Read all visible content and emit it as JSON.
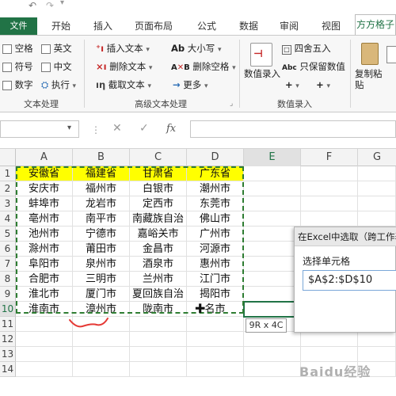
{
  "ribbon_tabs": [
    "文件",
    "开始",
    "插入",
    "页面布局",
    "公式",
    "数据",
    "审阅",
    "视图",
    "方方格子"
  ],
  "text_group": {
    "items": [
      "空格",
      "英文",
      "符号",
      "中文",
      "数字",
      "执行"
    ],
    "name": "文本处理"
  },
  "advanced_group": {
    "items": [
      "插入文本",
      "删除文本",
      "截取文本",
      "大小写",
      "删除空格",
      "更多"
    ],
    "name": "高级文本处理"
  },
  "number_group": {
    "big_button": "数值录入",
    "items": [
      "四舍五入",
      "只保留数值"
    ],
    "name": "数值录入"
  },
  "paste_button": "复制粘贴",
  "formula_bar": {
    "fx": "fx",
    "value": ""
  },
  "columns": [
    "A",
    "B",
    "C",
    "D",
    "E",
    "F",
    "G"
  ],
  "rows": [
    "1",
    "2",
    "3",
    "4",
    "5",
    "6",
    "7",
    "8",
    "9",
    "10",
    "11",
    "12",
    "13",
    "14"
  ],
  "table": [
    [
      "安徽省",
      "福建省",
      "甘肃省",
      "广东省"
    ],
    [
      "安庆市",
      "福州市",
      "白银市",
      "潮州市"
    ],
    [
      "蚌埠市",
      "龙岩市",
      "定西市",
      "东莞市"
    ],
    [
      "亳州市",
      "南平市",
      "南藏族自治",
      "佛山市"
    ],
    [
      "池州市",
      "宁德市",
      "嘉峪关市",
      "广州市"
    ],
    [
      "滁州市",
      "莆田市",
      "金昌市",
      "河源市"
    ],
    [
      "阜阳市",
      "泉州市",
      "酒泉市",
      "惠州市"
    ],
    [
      "合肥市",
      "三明市",
      "兰州市",
      "江门市"
    ],
    [
      "淮北市",
      "厦门市",
      "夏回族自治",
      "揭阳市"
    ],
    [
      "淮南市",
      "漳州市",
      "陇南市",
      "名市"
    ]
  ],
  "dialog": {
    "title": "在Excel中选取（跨工作表",
    "label": "选择单元格",
    "value": "$A$2:$D$10"
  },
  "selection_tip": "9R x 4C",
  "watermark": "Baidu经验",
  "colors": {
    "file_tab": "#217346",
    "header_fill": "#ffff00",
    "marching_ants": "#2e7d32",
    "annotation": "#e53935"
  }
}
